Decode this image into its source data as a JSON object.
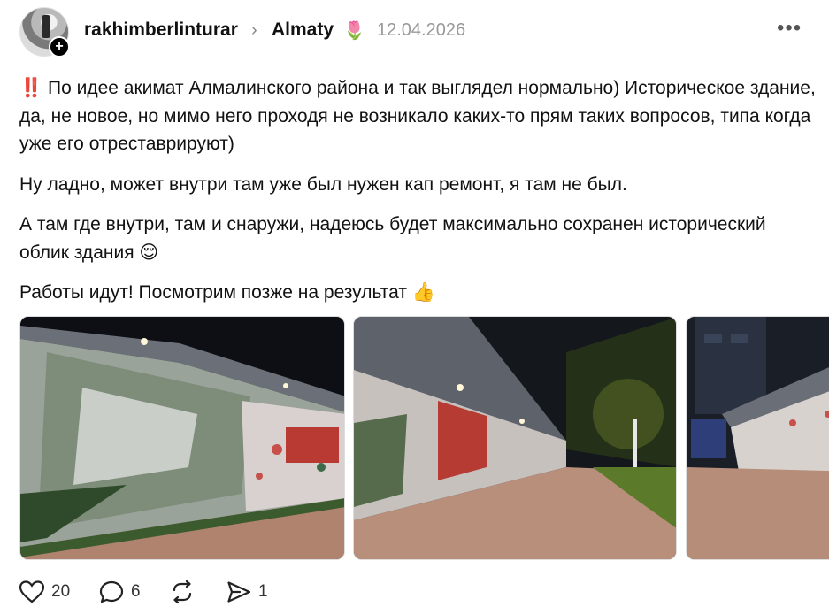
{
  "post": {
    "username": "rakhimberlinturar",
    "topic": "Almaty",
    "topic_emoji": "🌷",
    "date": "12.04.2026",
    "more_label": "•••",
    "paragraphs": [
      {
        "prefix": "‼️",
        "text": " По идее акимат Алмалинского района и так выглядел нормально) Историческое здание, да, не новое, но мимо него проходя не возникало каких-то прям таких вопросов, типа когда уже его отреставрируют)"
      },
      {
        "prefix": "",
        "text": "Ну ладно, может внутри там уже был нужен кап ремонт, я там не был."
      },
      {
        "prefix": "",
        "text": "А там где внутри, там и снаружи, надеюсь будет максимально сохранен исторический облик здания 😌"
      },
      {
        "prefix": "",
        "text": "Работы идут! Посмотрим позже на результат 👍"
      }
    ]
  },
  "actions": {
    "likes": "20",
    "comments": "6",
    "reposts": "",
    "shares": "1"
  },
  "icons": [
    "follow-plus-icon",
    "chevron-right-icon",
    "more-dots-icon",
    "heart-icon",
    "comment-icon",
    "repost-icon",
    "share-icon"
  ]
}
